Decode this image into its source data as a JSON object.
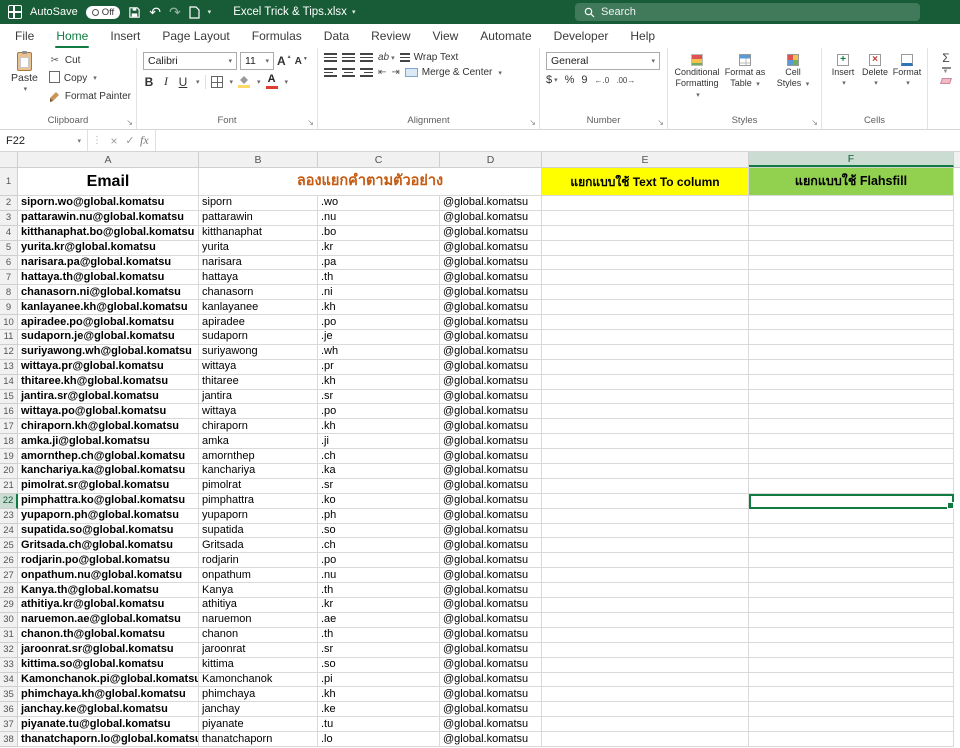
{
  "titlebar": {
    "autosave_label": "AutoSave",
    "autosave_state": "Off",
    "doc_title": "Excel Trick & Tips.xlsx",
    "search_placeholder": "Search"
  },
  "tabs": [
    {
      "label": "File",
      "active": false
    },
    {
      "label": "Home",
      "active": true
    },
    {
      "label": "Insert",
      "active": false
    },
    {
      "label": "Page Layout",
      "active": false
    },
    {
      "label": "Formulas",
      "active": false
    },
    {
      "label": "Data",
      "active": false
    },
    {
      "label": "Review",
      "active": false
    },
    {
      "label": "View",
      "active": false
    },
    {
      "label": "Automate",
      "active": false
    },
    {
      "label": "Developer",
      "active": false
    },
    {
      "label": "Help",
      "active": false
    }
  ],
  "ribbon": {
    "clipboard": {
      "label": "Clipboard",
      "paste": "Paste",
      "cut": "Cut",
      "copy": "Copy",
      "format_painter": "Format Painter"
    },
    "font": {
      "label": "Font",
      "family": "Calibri",
      "size": "11",
      "size_letter": "A",
      "bold": "B",
      "italic": "I",
      "underline": "U",
      "font_color_letter": "A"
    },
    "alignment": {
      "label": "Alignment",
      "orientation_icon": "ab",
      "wrap_text": "Wrap Text",
      "merge_center": "Merge & Center"
    },
    "number": {
      "label": "Number",
      "format": "General",
      "currency": "$",
      "percent": "%",
      "comma": "9",
      "increase_decimal": "←.0",
      "decrease_decimal": ".00→"
    },
    "styles": {
      "label": "Styles",
      "conditional_1": "Conditional",
      "conditional_2": "Formatting",
      "table_1": "Format as",
      "table_2": "Table",
      "cellstyles_1": "Cell",
      "cellstyles_2": "Styles"
    },
    "cells": {
      "label": "Cells",
      "insert": "Insert",
      "delete": "Delete",
      "format": "Format"
    },
    "editing": {
      "autosum": "Σ"
    }
  },
  "formula_bar": {
    "name_box": "F22",
    "fx_label": "fx"
  },
  "sheet": {
    "column_headers": [
      "A",
      "B",
      "C",
      "D",
      "E",
      "F"
    ],
    "selected": {
      "cell": "F22",
      "row": 22,
      "column": "F"
    },
    "row1_number": "1",
    "row1": {
      "email_header": "Email",
      "merged_title": "ลองแยกคำตามตัวอย่าง",
      "text_to_column_header": "แยกแบบใช้ Text To column",
      "flashfill_header": "แยกแบบใช้ Flahsfill"
    },
    "rows": [
      {
        "n": 2,
        "a": "siporn.wo@global.komatsu",
        "b": "siporn",
        "c": ".wo",
        "d": "@global.komatsu"
      },
      {
        "n": 3,
        "a": "pattarawin.nu@global.komatsu",
        "b": "pattarawin",
        "c": ".nu",
        "d": "@global.komatsu"
      },
      {
        "n": 4,
        "a": "kitthanaphat.bo@global.komatsu",
        "b": "kitthanaphat",
        "c": ".bo",
        "d": "@global.komatsu"
      },
      {
        "n": 5,
        "a": "yurita.kr@global.komatsu",
        "b": "yurita",
        "c": ".kr",
        "d": "@global.komatsu"
      },
      {
        "n": 6,
        "a": "narisara.pa@global.komatsu",
        "b": "narisara",
        "c": ".pa",
        "d": "@global.komatsu"
      },
      {
        "n": 7,
        "a": "hattaya.th@global.komatsu",
        "b": "hattaya",
        "c": ".th",
        "d": "@global.komatsu"
      },
      {
        "n": 8,
        "a": "chanasorn.ni@global.komatsu",
        "b": "chanasorn",
        "c": ".ni",
        "d": "@global.komatsu"
      },
      {
        "n": 9,
        "a": "kanlayanee.kh@global.komatsu",
        "b": "kanlayanee",
        "c": ".kh",
        "d": "@global.komatsu"
      },
      {
        "n": 10,
        "a": "apiradee.po@global.komatsu",
        "b": "apiradee",
        "c": ".po",
        "d": "@global.komatsu"
      },
      {
        "n": 11,
        "a": "sudaporn.je@global.komatsu",
        "b": "sudaporn",
        "c": ".je",
        "d": "@global.komatsu"
      },
      {
        "n": 12,
        "a": "suriyawong.wh@global.komatsu",
        "b": "suriyawong",
        "c": ".wh",
        "d": "@global.komatsu"
      },
      {
        "n": 13,
        "a": "wittaya.pr@global.komatsu",
        "b": "wittaya",
        "c": ".pr",
        "d": "@global.komatsu"
      },
      {
        "n": 14,
        "a": "thitaree.kh@global.komatsu",
        "b": "thitaree",
        "c": ".kh",
        "d": "@global.komatsu"
      },
      {
        "n": 15,
        "a": "jantira.sr@global.komatsu",
        "b": "jantira",
        "c": ".sr",
        "d": "@global.komatsu"
      },
      {
        "n": 16,
        "a": "wittaya.po@global.komatsu",
        "b": "wittaya",
        "c": ".po",
        "d": "@global.komatsu"
      },
      {
        "n": 17,
        "a": "chiraporn.kh@global.komatsu",
        "b": "chiraporn",
        "c": ".kh",
        "d": "@global.komatsu"
      },
      {
        "n": 18,
        "a": "amka.ji@global.komatsu",
        "b": "amka",
        "c": ".ji",
        "d": "@global.komatsu"
      },
      {
        "n": 19,
        "a": "amornthep.ch@global.komatsu",
        "b": "amornthep",
        "c": ".ch",
        "d": "@global.komatsu"
      },
      {
        "n": 20,
        "a": "kanchariya.ka@global.komatsu",
        "b": "kanchariya",
        "c": ".ka",
        "d": "@global.komatsu"
      },
      {
        "n": 21,
        "a": "pimolrat.sr@global.komatsu",
        "b": "pimolrat",
        "c": ".sr",
        "d": "@global.komatsu"
      },
      {
        "n": 22,
        "a": "pimphattra.ko@global.komatsu",
        "b": "pimphattra",
        "c": ".ko",
        "d": "@global.komatsu"
      },
      {
        "n": 23,
        "a": "yupaporn.ph@global.komatsu",
        "b": "yupaporn",
        "c": ".ph",
        "d": "@global.komatsu"
      },
      {
        "n": 24,
        "a": "supatida.so@global.komatsu",
        "b": "supatida",
        "c": ".so",
        "d": "@global.komatsu"
      },
      {
        "n": 25,
        "a": "Gritsada.ch@global.komatsu",
        "b": "Gritsada",
        "c": ".ch",
        "d": "@global.komatsu"
      },
      {
        "n": 26,
        "a": "rodjarin.po@global.komatsu",
        "b": "rodjarin",
        "c": ".po",
        "d": "@global.komatsu"
      },
      {
        "n": 27,
        "a": "onpathum.nu@global.komatsu",
        "b": "onpathum",
        "c": ".nu",
        "d": "@global.komatsu"
      },
      {
        "n": 28,
        "a": "Kanya.th@global.komatsu",
        "b": "Kanya",
        "c": ".th",
        "d": "@global.komatsu"
      },
      {
        "n": 29,
        "a": "athitiya.kr@global.komatsu",
        "b": "athitiya",
        "c": ".kr",
        "d": "@global.komatsu"
      },
      {
        "n": 30,
        "a": "naruemon.ae@global.komatsu",
        "b": "naruemon",
        "c": ".ae",
        "d": "@global.komatsu"
      },
      {
        "n": 31,
        "a": "chanon.th@global.komatsu",
        "b": "chanon",
        "c": ".th",
        "d": "@global.komatsu"
      },
      {
        "n": 32,
        "a": "jaroonrat.sr@global.komatsu",
        "b": "jaroonrat",
        "c": ".sr",
        "d": "@global.komatsu"
      },
      {
        "n": 33,
        "a": "kittima.so@global.komatsu",
        "b": "kittima",
        "c": ".so",
        "d": "@global.komatsu"
      },
      {
        "n": 34,
        "a": "Kamonchanok.pi@global.komatsu",
        "b": "Kamonchanok",
        "c": ".pi",
        "d": "@global.komatsu"
      },
      {
        "n": 35,
        "a": "phimchaya.kh@global.komatsu",
        "b": "phimchaya",
        "c": ".kh",
        "d": "@global.komatsu"
      },
      {
        "n": 36,
        "a": "janchay.ke@global.komatsu",
        "b": "janchay",
        "c": ".ke",
        "d": "@global.komatsu"
      },
      {
        "n": 37,
        "a": "piyanate.tu@global.komatsu",
        "b": "piyanate",
        "c": ".tu",
        "d": "@global.komatsu"
      },
      {
        "n": 38,
        "a": "thanatchaporn.lo@global.komatsu",
        "b": "thanatchaporn",
        "c": ".lo",
        "d": "@global.komatsu"
      }
    ]
  },
  "colors": {
    "titlebar_green": "#185C37",
    "accent_green": "#107C41",
    "yellow_fill": "#FFFF00",
    "green_fill": "#92D050",
    "orange_text": "#C55A11"
  }
}
